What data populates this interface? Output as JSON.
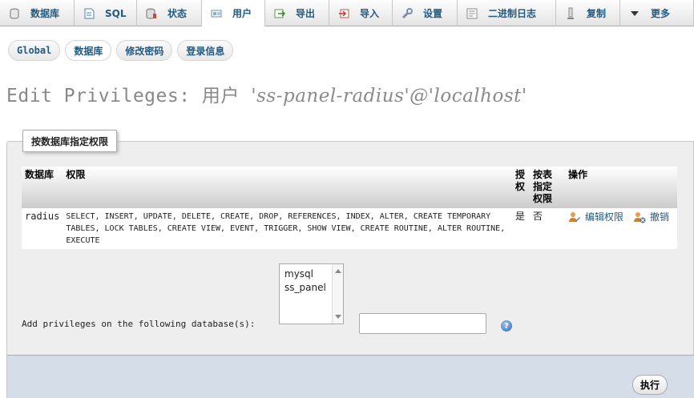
{
  "topnav": [
    {
      "label": "数据库",
      "icon": "database-icon"
    },
    {
      "label": "SQL",
      "icon": "sql-icon"
    },
    {
      "label": "状态",
      "icon": "status-icon"
    },
    {
      "label": "用户",
      "icon": "users-icon",
      "active": true
    },
    {
      "label": "导出",
      "icon": "export-icon"
    },
    {
      "label": "导入",
      "icon": "import-icon"
    },
    {
      "label": "设置",
      "icon": "settings-icon"
    },
    {
      "label": "二进制日志",
      "icon": "binlog-icon"
    },
    {
      "label": "复制",
      "icon": "replication-icon"
    },
    {
      "label": "更多",
      "icon": "more-icon"
    }
  ],
  "subtabs": [
    {
      "label": "Global"
    },
    {
      "label": "数据库",
      "active": true
    },
    {
      "label": "修改密码"
    },
    {
      "label": "登录信息"
    }
  ],
  "title": {
    "prefix": "Edit Privileges: 用户",
    "user": "'ss-panel-radius'@'localhost'"
  },
  "fieldset": {
    "legend": "按数据库指定权限"
  },
  "table": {
    "headers": {
      "db": "数据库",
      "privileges": "权限",
      "grant": "授权",
      "table_specific": "按表指定权限",
      "action": "操作"
    },
    "rows": [
      {
        "db": "radius",
        "privileges": "SELECT, INSERT, UPDATE, DELETE, CREATE, DROP, REFERENCES, INDEX, ALTER, CREATE TEMPORARY TABLES, LOCK TABLES, CREATE VIEW, EVENT, TRIGGER, SHOW VIEW, CREATE ROUTINE, ALTER ROUTINE, EXECUTE",
        "grant": "是",
        "table_specific": "否",
        "edit_label": "编辑权限",
        "revoke_label": "撤销"
      }
    ]
  },
  "add_privileges": {
    "label": "Add privileges on the following database(s):",
    "options": [
      "mysql",
      "ss_panel"
    ],
    "input_value": ""
  },
  "go_button": "执行"
}
